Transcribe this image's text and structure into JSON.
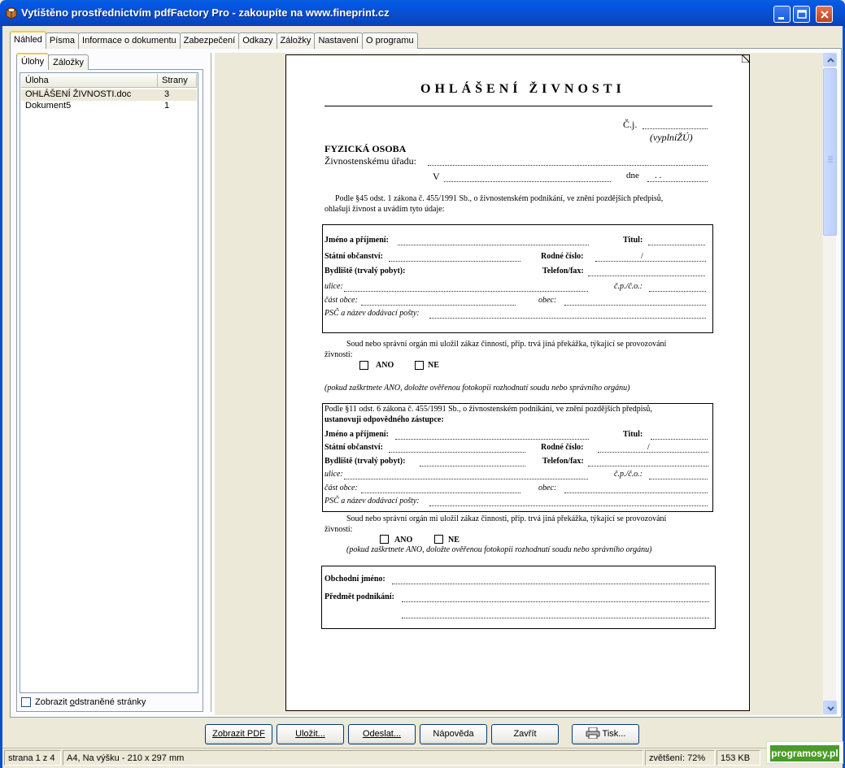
{
  "window": {
    "title": "Vytištěno prostřednictvím pdfFactory Pro - zakoupíte na www.fineprint.cz"
  },
  "tabs": [
    "Náhled",
    "Písma",
    "Informace o dokumentu",
    "Zabezpečení",
    "Odkazy",
    "Záložky",
    "Nastavení",
    "O programu"
  ],
  "left_panel": {
    "tabs": [
      "Úlohy",
      "Záložky"
    ],
    "columns": [
      "Úloha",
      "Strany"
    ],
    "rows": [
      {
        "name": "OHLÁŠENÍ ŽIVNOSTI.doc",
        "pages": "3"
      },
      {
        "name": "Dokument5",
        "pages": "1"
      }
    ],
    "show_removed_prefix": "Zobrazit ",
    "show_removed_u": "o",
    "show_removed_suffix": "dstraněné stránky"
  },
  "buttons": {
    "show_pdf": "Zobrazit PDF",
    "save": "Uložit...",
    "send": "Odeslat...",
    "help": "Nápověda",
    "close": "Zavřít",
    "print": "Tisk..."
  },
  "status": {
    "page": "strana 1 z 4",
    "format": "A4, Na výšku - 210 x 297 mm",
    "zoom": "zvětšení: 72%",
    "size": "153 KB"
  },
  "watermark": "programosy.pl",
  "document": {
    "title": "OHLÁŠENÍ ŽIVNOSTI",
    "cj": "Č.j.",
    "cj_note": "(vyplníŽÚ)",
    "fyzicka_osoba": "FYZICKÁ OSOBA",
    "urad": "Živnostenskému úřadu:",
    "v": "V",
    "dne": "dne",
    "dne_dots": ". .",
    "intro1": "Podle §45 odst. 1 zákona č. 455/1991 Sb., o živnostenském podnikání, ve znění pozdějších předpisů,",
    "intro2": "ohlašuji živnost a uvádím tyto údaje:",
    "jmeno": "Jméno a příjmení:",
    "titul": "Titul:",
    "obcanstvi": "Státní občanství:",
    "rodne": "Rodné číslo:",
    "slash": "/",
    "bydliste": "Bydliště (trvalý pobyt):",
    "telefon": "Telefon/fax:",
    "ulice": "ulice:",
    "cp": "č.p./č.o.:",
    "cast": "část obce:",
    "obec": "obec:",
    "psc": "PSČ a název dodávací pošty:",
    "soud1": "Soud nebo správní orgán mi uložil zákaz činnosti, příp. trvá jiná překážka, týkající se provozování",
    "soud2": "živnosti:",
    "ano": "ANO",
    "ne": "NE",
    "pokud1": "(pokud zaškrtnete ANO, doložte ověřenou fotokopii rozhodnutí soudu nebo správního orgánu)",
    "zast1": "Podle §11 odst. 6 zákona č. 455/1991 Sb., o živnostenském podnikání, ve znění pozdějších předpisů,",
    "zast2": "ustanovuji odpovědného zástupce:",
    "pokud2": "(pokud zaškrtnete ANO, doložte ověřenou fotokopii rozhodnutí soudu nebo správního orgánu)",
    "obchodni": "Obchodní jméno:",
    "predmet": "Předmět podnikání:"
  }
}
